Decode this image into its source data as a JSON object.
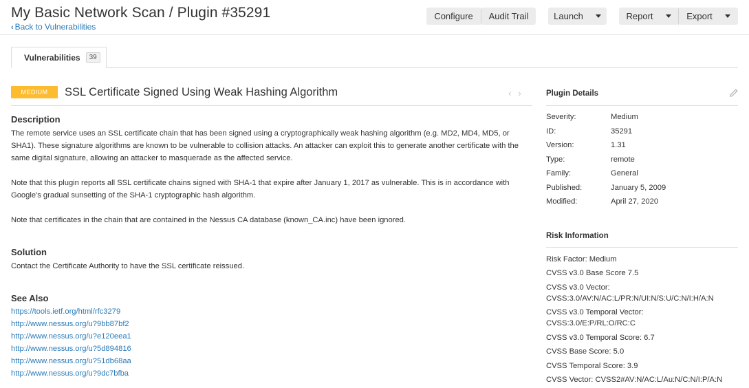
{
  "header": {
    "title": "My Basic Network Scan / Plugin #35291",
    "back_label": "Back to Vulnerabilities",
    "buttons": {
      "configure": "Configure",
      "audit_trail": "Audit Trail",
      "launch": "Launch",
      "report": "Report",
      "export": "Export"
    }
  },
  "tabs": {
    "vulnerabilities": {
      "label": "Vulnerabilities",
      "count": "39"
    }
  },
  "vuln": {
    "severity": "Medium",
    "title": "SSL Certificate Signed Using Weak Hashing Algorithm",
    "description_heading": "Description",
    "description": [
      "The remote service uses an SSL certificate chain that has been signed using a cryptographically weak hashing algorithm (e.g. MD2, MD4, MD5, or SHA1). These signature algorithms are known to be vulnerable to collision attacks. An attacker can exploit this to generate another certificate with the same digital signature, allowing an attacker to masquerade as the affected service.",
      "Note that this plugin reports all SSL certificate chains signed with SHA-1 that expire after January 1, 2017 as vulnerable. This is in accordance with Google's gradual sunsetting of the SHA-1 cryptographic hash algorithm.",
      "Note that certificates in the chain that are contained in the Nessus CA database (known_CA.inc) have been ignored."
    ],
    "solution_heading": "Solution",
    "solution": "Contact the Certificate Authority to have the SSL certificate reissued.",
    "see_also_heading": "See Also",
    "see_also": [
      "https://tools.ietf.org/html/rfc3279",
      "http://www.nessus.org/u?9bb87bf2",
      "http://www.nessus.org/u?e120eea1",
      "http://www.nessus.org/u?5d894816",
      "http://www.nessus.org/u?51db68aa",
      "http://www.nessus.org/u?9dc7bfba"
    ]
  },
  "plugin_details": {
    "heading": "Plugin Details",
    "rows": [
      {
        "key": "Severity:",
        "value": "Medium"
      },
      {
        "key": "ID:",
        "value": "35291"
      },
      {
        "key": "Version:",
        "value": "1.31"
      },
      {
        "key": "Type:",
        "value": "remote"
      },
      {
        "key": "Family:",
        "value": "General"
      },
      {
        "key": "Published:",
        "value": "January 5, 2009"
      },
      {
        "key": "Modified:",
        "value": "April 27, 2020"
      }
    ]
  },
  "risk_information": {
    "heading": "Risk Information",
    "items": [
      "Risk Factor: Medium",
      "CVSS v3.0 Base Score 7.5",
      "CVSS v3.0 Vector:",
      "CVSS:3.0/AV:N/AC:L/PR:N/UI:N/S:U/C:N/I:H/A:N",
      "CVSS v3.0 Temporal Vector:",
      "CVSS:3.0/E:P/RL:O/RC:C",
      "CVSS v3.0 Temporal Score: 6.7",
      "CVSS Base Score: 5.0",
      "CVSS Temporal Score: 3.9",
      "CVSS Vector: CVSS2#AV:N/AC:L/Au:N/C:N/I:P/A:N"
    ]
  },
  "colors": {
    "medium": "#fdbb2f",
    "link": "#2a7ab8",
    "button_bg": "#ececec"
  },
  "icons": {
    "back": "chevron-left-icon",
    "prev": "chevron-left-icon",
    "next": "chevron-right-icon",
    "edit": "pencil-icon",
    "dropdown": "caret-down-icon"
  }
}
